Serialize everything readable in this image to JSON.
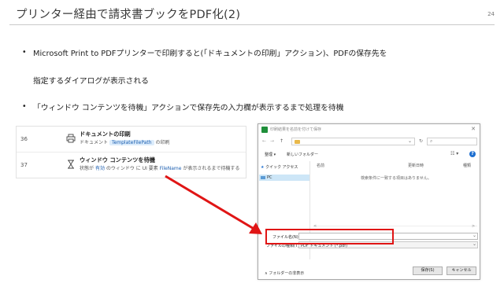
{
  "slide": {
    "title": "プリンター経由で請求書ブックをPDF化(2)",
    "page_number": "24",
    "bullets": [
      {
        "marker": "•",
        "lines": [
          "Microsoft Print to PDFプリンターで印刷すると(「ドキュメントの印刷」アクション)、PDFの保存先を",
          "指定するダイアログが表示される"
        ]
      },
      {
        "marker": "•",
        "lines": [
          "「ウィンドウ コンテンツを待機」アクションで保存先の入力欄が表示するまで処理を待機"
        ]
      }
    ]
  },
  "flow": {
    "rows": [
      {
        "line": "36",
        "icon": "printer-icon",
        "title": "ドキュメントの印刷",
        "desc_prefix": "ドキュメント",
        "desc_var": "TemplateFilePath",
        "desc_suffix": "の印刷"
      },
      {
        "line": "37",
        "icon": "hourglass-icon",
        "title": "ウィンドウ コンテンツを待機",
        "desc_a": "状態が",
        "desc_state": "有効",
        "desc_b": "のウィンドウ に UI 要素",
        "desc_el": "FileName",
        "desc_c": "が表示されるまで待機する"
      }
    ]
  },
  "dialog": {
    "title": "印刷結果を名前を付けて保存",
    "close": "✕",
    "nav": {
      "back": "←",
      "forward": "→",
      "up": "↑",
      "refresh": "↻",
      "dropdown": "⌄",
      "search_icon": "⌕"
    },
    "toolbar": {
      "organize": "整理 ▾",
      "new_folder": "新しいフォルダー",
      "view": "☷ ▾",
      "help": "?"
    },
    "nav_pane": {
      "quick_access": "クイック アクセス",
      "pc": "PC"
    },
    "columns": {
      "name": "名前",
      "date": "更新日時",
      "type": "種類"
    },
    "empty_message": "検索条件に一致する項目はありません。",
    "filename_label": "ファイル名(N):",
    "filename_value": "",
    "filetype_label": "ファイルの種類(T):",
    "filetype_value": "PDF ドキュメント (*.pdf)",
    "hide_folders": "∧ フォルダーの非表示",
    "save_button": "保存(S)",
    "cancel_button": "キャンセル"
  },
  "colors": {
    "highlight": "#e01515",
    "accent": "#1d5fb0"
  }
}
